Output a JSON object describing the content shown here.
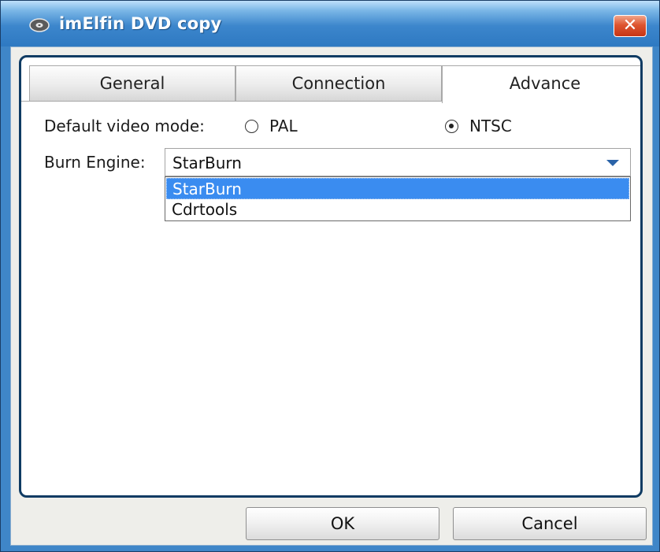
{
  "window": {
    "title": "imElfin DVD copy",
    "close_glyph": "✕",
    "icon": "dvd-disc-icon"
  },
  "tabs": [
    {
      "label": "General",
      "active": false
    },
    {
      "label": "Connection",
      "active": false
    },
    {
      "label": "Advance",
      "active": true
    }
  ],
  "video_mode": {
    "label": "Default video mode:",
    "options": [
      {
        "label": "PAL",
        "selected": false
      },
      {
        "label": "NTSC",
        "selected": true
      }
    ]
  },
  "burn_engine": {
    "label": "Burn Engine:",
    "value": "StarBurn",
    "options": [
      "StarBurn",
      "Cdrtools"
    ],
    "selected_index": 0
  },
  "buttons": {
    "ok": "OK",
    "cancel": "Cancel"
  },
  "colors": {
    "title_bar": "#3c86cc",
    "close_button": "#de5530",
    "selection": "#3a8cf0",
    "panel_border": "#0f3b63"
  }
}
